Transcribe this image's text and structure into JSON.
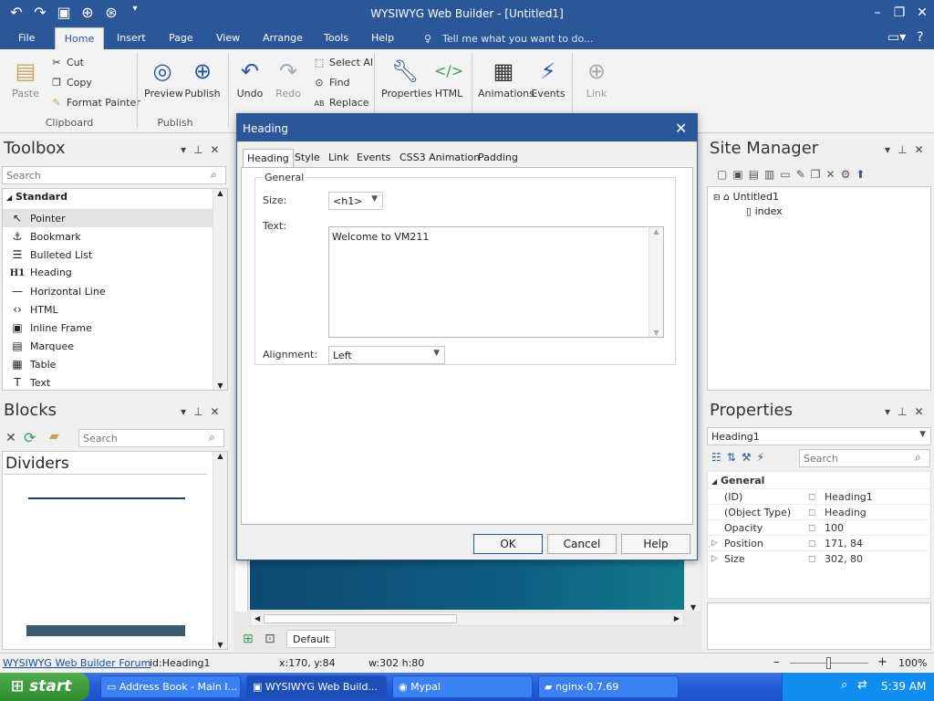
{
  "app": {
    "title": "WYSIWYG Web Builder - [Untitled1]"
  },
  "menu": {
    "tabs": [
      "File",
      "Home",
      "Insert",
      "Page",
      "View",
      "Arrange",
      "Tools",
      "Help"
    ],
    "tell_me": "Tell me what you want to do..."
  },
  "ribbon": {
    "paste": "Paste",
    "cut": "Cut",
    "copy": "Copy",
    "format_painter": "Format Painter",
    "clipboard": "Clipboard",
    "preview": "Preview",
    "publish": "Publish",
    "publish_group": "Publish",
    "undo": "Undo",
    "redo": "Redo",
    "select_all": "Select All",
    "find": "Find",
    "replace": "Replace",
    "properties": "Properties",
    "html": "HTML",
    "animations": "Animations",
    "events": "Events",
    "link": "Link"
  },
  "toolbox": {
    "title": "Toolbox",
    "search_placeholder": "Search",
    "section": "Standard",
    "items": [
      {
        "label": "Pointer",
        "icon": "pointer-icon"
      },
      {
        "label": "Bookmark",
        "icon": "anchor-icon"
      },
      {
        "label": "Bulleted List",
        "icon": "list-icon"
      },
      {
        "label": "Heading",
        "icon": "heading-icon"
      },
      {
        "label": "Horizontal Line",
        "icon": "hr-icon"
      },
      {
        "label": "HTML",
        "icon": "code-icon"
      },
      {
        "label": "Inline Frame",
        "icon": "frame-icon"
      },
      {
        "label": "Marquee",
        "icon": "marquee-icon"
      },
      {
        "label": "Table",
        "icon": "table-icon"
      },
      {
        "label": "Text",
        "icon": "text-icon"
      }
    ]
  },
  "blocks": {
    "title": "Blocks",
    "search_placeholder": "Search",
    "section": "Dividers"
  },
  "site_manager": {
    "title": "Site Manager",
    "root": "Untitled1",
    "page": "index"
  },
  "properties": {
    "title": "Properties",
    "selected": "Heading1",
    "search_placeholder": "Search",
    "group": "General",
    "rows": [
      {
        "name": "(ID)",
        "value": "Heading1",
        "expand": ""
      },
      {
        "name": "(Object Type)",
        "value": "Heading",
        "expand": ""
      },
      {
        "name": "Opacity",
        "value": "100",
        "expand": ""
      },
      {
        "name": "Position",
        "value": "171, 84",
        "expand": "▷"
      },
      {
        "name": "Size",
        "value": "302, 80",
        "expand": "▷"
      }
    ]
  },
  "dialog": {
    "title": "Heading",
    "tabs": [
      "Heading",
      "Style",
      "Link",
      "Events",
      "CSS3 Animation",
      "Padding"
    ],
    "group": "General",
    "size_label": "Size:",
    "size_value": "<h1>",
    "text_label": "Text:",
    "text_value": "Welcome to VM211",
    "alignment_label": "Alignment:",
    "alignment_value": "Left",
    "ok": "OK",
    "cancel": "Cancel",
    "help": "Help"
  },
  "canvas": {
    "page_tab": "Default"
  },
  "status": {
    "forum": "WYSIWYG Web Builder Forum",
    "id": "id:Heading1",
    "pos": "x:170, y:84",
    "dim": "w:302 h:80",
    "zoom": "100%"
  },
  "taskbar": {
    "start": "start",
    "tasks": [
      "Address Book - Main I...",
      "WYSIWYG Web Build...",
      "Mypal",
      "nginx-0.7.69"
    ],
    "time": "5:39 AM"
  },
  "colors": {
    "accent": "#2b579a",
    "canvas": "#0e5e82"
  }
}
